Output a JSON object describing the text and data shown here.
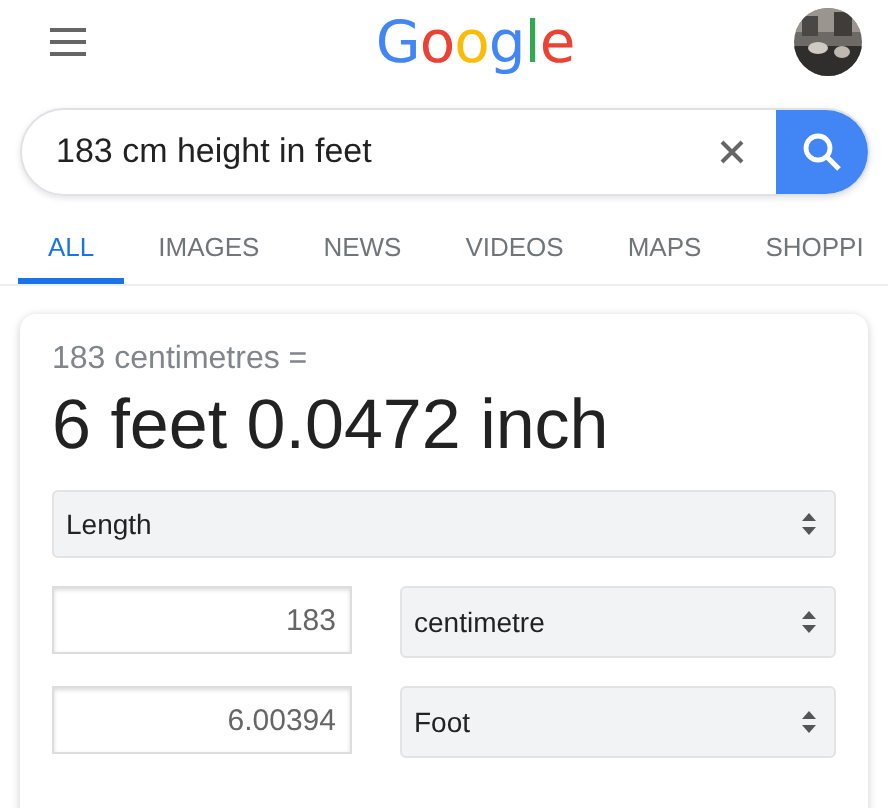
{
  "header": {
    "logo": "Google"
  },
  "search": {
    "value": "183 cm height in feet"
  },
  "tabs": [
    {
      "label": "ALL",
      "selected": true
    },
    {
      "label": "IMAGES",
      "selected": false
    },
    {
      "label": "NEWS",
      "selected": false
    },
    {
      "label": "VIDEOS",
      "selected": false
    },
    {
      "label": "MAPS",
      "selected": false
    },
    {
      "label": "SHOPPI",
      "selected": false
    }
  ],
  "converter": {
    "query": "183 centimetres =",
    "result": "6 feet 0.0472 inch",
    "category": "Length",
    "rows": [
      {
        "value": "183",
        "unit": "centimetre"
      },
      {
        "value": "6.00394",
        "unit": "Foot"
      }
    ]
  }
}
